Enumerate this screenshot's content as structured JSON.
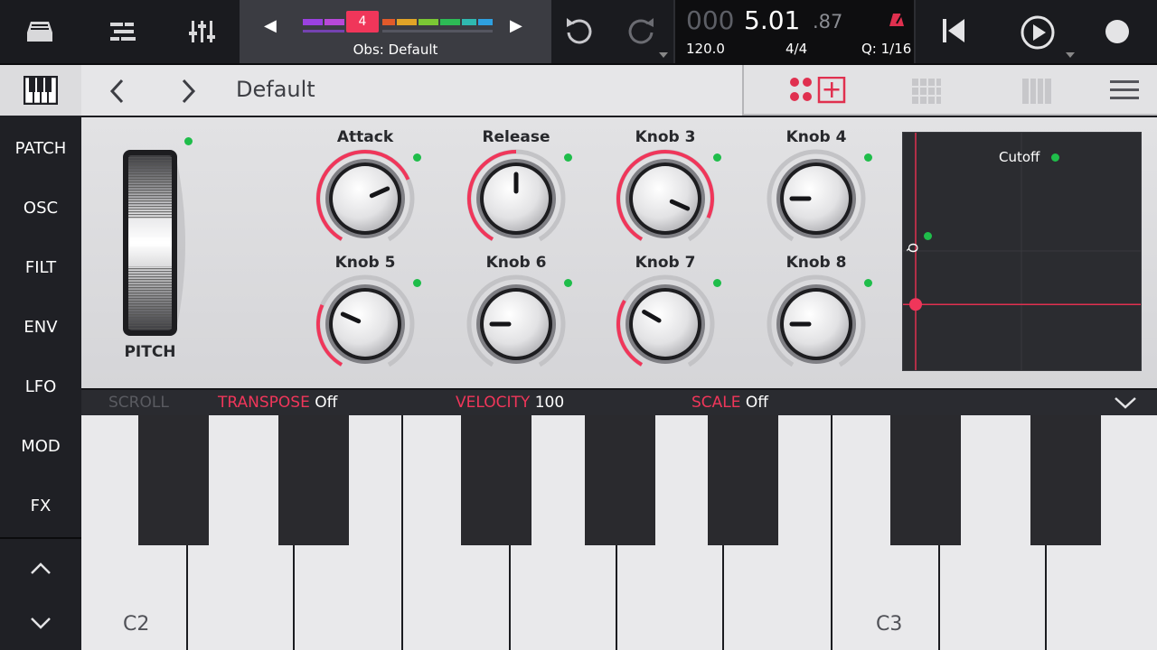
{
  "colors": {
    "accent": "#f0365a",
    "green": "#1fbd4a"
  },
  "topbar": {
    "track_number": "4",
    "track_name": "Obs: Default",
    "position_dim": "000",
    "position_bright": "5.01",
    "position_ticks": ".87",
    "tempo": "120.0",
    "time_signature": "4/4",
    "quantize": "Q: 1/16"
  },
  "sidebar": {
    "items": [
      "PATCH",
      "OSC",
      "FILT",
      "ENV",
      "LFO",
      "MOD",
      "FX"
    ]
  },
  "header": {
    "preset_name": "Default"
  },
  "panel": {
    "pitch_label": "PITCH",
    "knobs": [
      {
        "label": "Attack",
        "value": 0.72,
        "arc": true
      },
      {
        "label": "Release",
        "value": 0.5,
        "arc": true
      },
      {
        "label": "Knob 3",
        "value": 0.88,
        "arc": true
      },
      {
        "label": "Knob 4",
        "value": 0.2,
        "arc": false
      },
      {
        "label": "Knob 5",
        "value": 0.28,
        "arc": true
      },
      {
        "label": "Knob 6",
        "value": 0.2,
        "arc": false
      },
      {
        "label": "Knob 7",
        "value": 0.3,
        "arc": true
      },
      {
        "label": "Knob 8",
        "value": 0.2,
        "arc": false
      }
    ],
    "xy_pad": {
      "x_label": "Cutoff",
      "y_label": "Q",
      "x": 0.0,
      "y": 0.25
    }
  },
  "keyboard_toolbar": {
    "scroll": "SCROLL",
    "transpose_key": "TRANSPOSE",
    "transpose_val": "Off",
    "velocity_key": "VELOCITY",
    "velocity_val": "100",
    "scale_key": "SCALE",
    "scale_val": "Off"
  },
  "piano": {
    "label_c2": "C2",
    "label_c3": "C3"
  }
}
